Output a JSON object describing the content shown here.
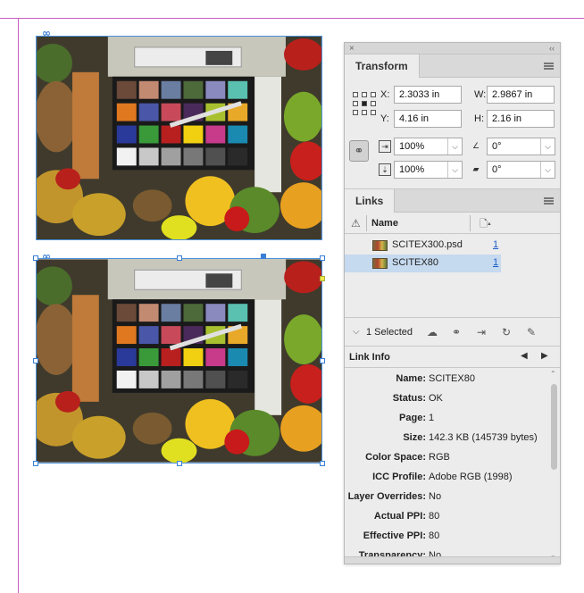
{
  "panel": {
    "close_glyph": "×",
    "collapse_glyph": "‹‹",
    "menu_icon": "panel-menu-icon"
  },
  "transform": {
    "tab_label": "Transform",
    "x_label": "X:",
    "x_value": "2.3033 in",
    "y_label": "Y:",
    "y_value": "4.16 in",
    "w_label": "W:",
    "w_value": "2.9867 in",
    "h_label": "H:",
    "h_value": "2.16 in",
    "scale_x": "100%",
    "scale_y": "100%",
    "rotation": "0°",
    "shear": "0°"
  },
  "links": {
    "tab_label": "Links",
    "col_name": "Name",
    "items": [
      {
        "name": "SCITEX300.psd",
        "page": "1",
        "selected": false
      },
      {
        "name": "SCITEX80",
        "page": "1",
        "selected": true
      }
    ],
    "selected_count": "1 Selected"
  },
  "link_info": {
    "title": "Link Info",
    "rows": [
      {
        "key": "Name:",
        "value": "SCITEX80"
      },
      {
        "key": "Status:",
        "value": "OK"
      },
      {
        "key": "Page:",
        "value": "1"
      },
      {
        "key": "Size:",
        "value": "142.3 KB (145739 bytes)"
      },
      {
        "key": "Color Space:",
        "value": "RGB"
      },
      {
        "key": "ICC Profile:",
        "value": "Adobe RGB (1998)"
      },
      {
        "key": "Layer Overrides:",
        "value": "No"
      },
      {
        "key": "Actual PPI:",
        "value": "80"
      },
      {
        "key": "Effective PPI:",
        "value": "80"
      },
      {
        "key": "Transparency:",
        "value": "No"
      }
    ]
  },
  "colors": {
    "selection": "#4a90d9",
    "page_edge": "#c85fc0",
    "link_blue": "#1a5fc8"
  }
}
